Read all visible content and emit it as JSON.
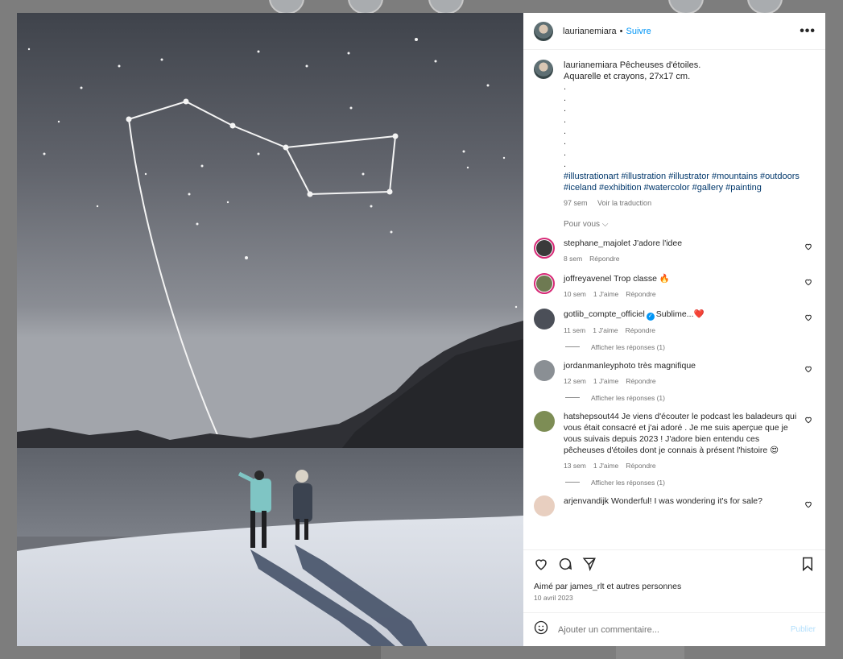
{
  "post": {
    "username": "laurianemiara",
    "follow_label": "Suivre",
    "more_label": "•••",
    "caption_title": "Pêcheuses d'étoiles.",
    "caption_line2": "Aquarelle et crayons, 27x17 cm.",
    "caption_dots": [
      ".",
      ".",
      ".",
      ".",
      ".",
      ".",
      ".",
      "."
    ],
    "hashtags_line1": "#illustrationart #illustration #illustrator #mountains #outdoors",
    "hashtags_line2": "#iceland #exhibition #watercolor #gallery #painting",
    "age": "97 sem",
    "translate_label": "Voir la traduction",
    "pour_vous": "Pour vous",
    "chevron": "⌵"
  },
  "comments": [
    {
      "user": "stephane_majolet",
      "text": "J'adore l'idee",
      "time": "8 sem",
      "likes": "",
      "reply": "Répondre",
      "avatar_color": "#3a3a3a",
      "ring": true
    },
    {
      "user": "joffreyavenel",
      "text": "Trop classe 🔥",
      "time": "10 sem",
      "likes": "1 J'aime",
      "reply": "Répondre",
      "avatar_color": "#6e7a52",
      "ring": true
    },
    {
      "user": "gotlib_compte_officiel",
      "verified": "✓",
      "text": "Sublime...❤️",
      "time": "11 sem",
      "likes": "1 J'aime",
      "reply": "Répondre",
      "avatar_color": "#4b4f58",
      "ring": false,
      "replies": "Afficher les réponses (1)"
    },
    {
      "user": "jordanmanleyphoto",
      "text": "très magnifique",
      "time": "12 sem",
      "likes": "1 J'aime",
      "reply": "Répondre",
      "avatar_color": "#8a8f94",
      "ring": false,
      "replies": "Afficher les réponses (1)"
    },
    {
      "user": "hatshepsout44",
      "text": "Je viens d'écouter le podcast les baladeurs qui vous était consacré et j'ai adoré . Je me suis aperçue que je vous suivais depuis 2023 ! J'adore bien entendu ces pêcheuses d'étoiles dont je connais à présent l'histoire 😍",
      "time": "13 sem",
      "likes": "1 J'aime",
      "reply": "Répondre",
      "avatar_color": "#7d8d55",
      "ring": false,
      "replies": "Afficher les réponses (1)"
    },
    {
      "user": "arjenvandijk",
      "text": "Wonderful! I was wondering it's for sale?",
      "time": "",
      "likes": "",
      "reply": "",
      "avatar_color": "#e8cfc0",
      "ring": false
    }
  ],
  "footer": {
    "liked_prefix": "Aimé par",
    "liked_user": "james_rlt",
    "liked_suffix": "et autres personnes",
    "date": "10 avril 2023",
    "comment_placeholder": "Ajouter un commentaire...",
    "publish_label": "Publier"
  },
  "icons": {
    "like": "heart-icon",
    "comment": "comment-icon",
    "share": "share-icon",
    "save": "bookmark-icon",
    "emoji": "emoji-icon"
  },
  "colors": {
    "link": "#0095f6",
    "hashtag": "#00376b",
    "muted": "#737373",
    "story_ring": "#d62976"
  }
}
